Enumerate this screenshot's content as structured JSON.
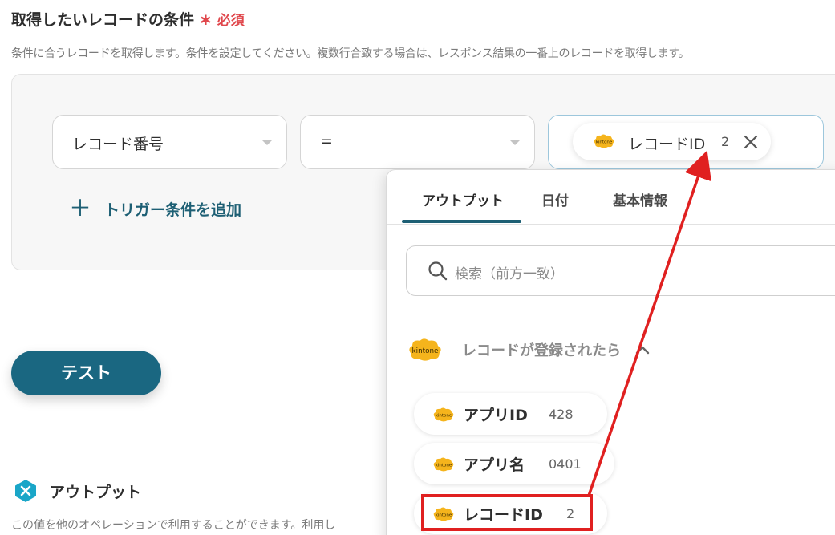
{
  "section": {
    "title": "取得したいレコードの条件",
    "required_mark": "∗",
    "required_label": "必須",
    "description": "条件に合うレコードを取得します。条件を設定してください。複数行合致する場合は、レスポンス結果の一番上のレコードを取得します。"
  },
  "condition": {
    "field_value": "レコード番号",
    "operator_value": "=",
    "value_chip": {
      "label": "レコードID",
      "number": "2"
    },
    "add_label": "トリガー条件を追加"
  },
  "test_button": "テスト",
  "output": {
    "title": "アウトプット",
    "description": "この値を他のオペレーションで利用することができます。利用し"
  },
  "dropdown": {
    "tabs": [
      "アウトプット",
      "日付",
      "基本情報"
    ],
    "active_tab": "アウトプット",
    "search_placeholder": "検索（前方一致）",
    "group_label": "レコードが登録されたら",
    "items": [
      {
        "name": "アプリID",
        "value": "428"
      },
      {
        "name": "アプリ名",
        "value": "0401"
      },
      {
        "name": "レコードID",
        "value": "2"
      }
    ]
  },
  "logo_text": "kintone",
  "colors": {
    "accent": "#1a6781",
    "required": "#e0474c",
    "kintone": "#f5b41c",
    "annotation": "#e02020"
  }
}
